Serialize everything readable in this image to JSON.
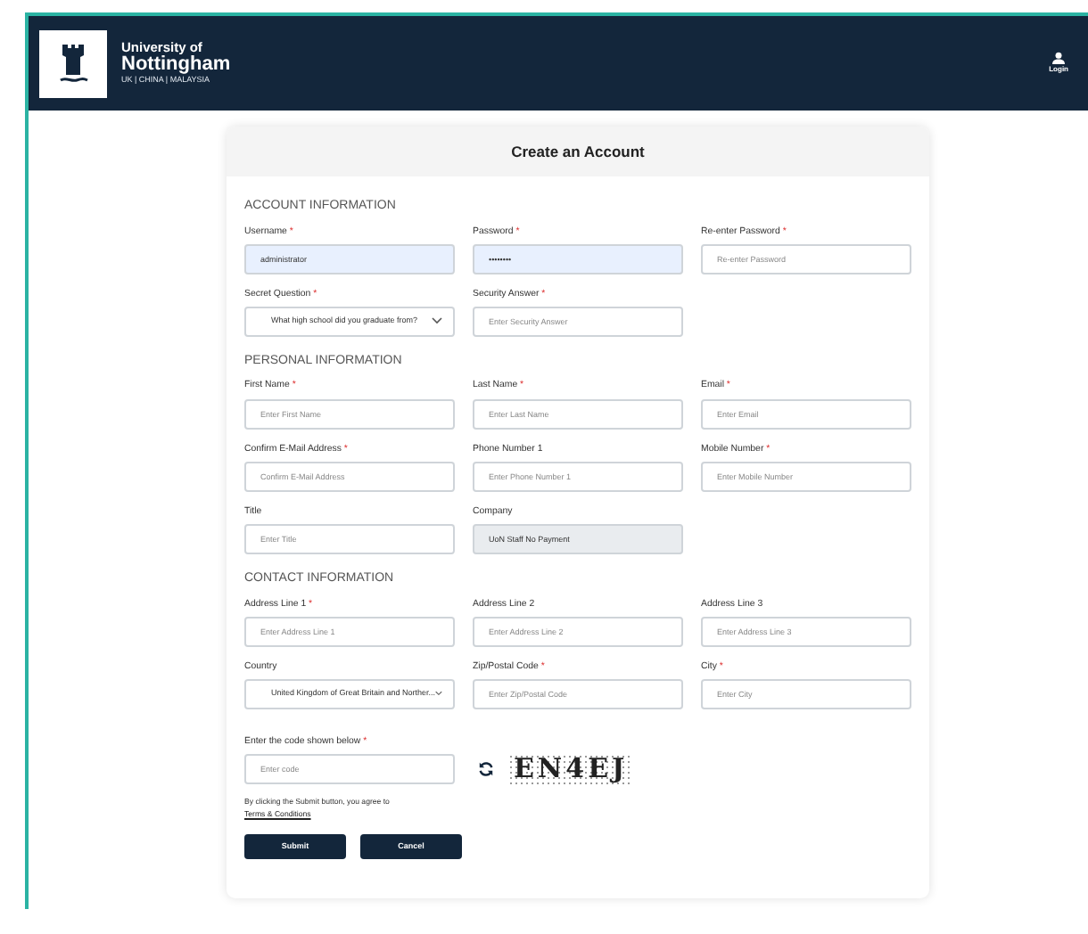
{
  "header": {
    "logo_lines": [
      "University of",
      "Nottingham",
      "UK | CHINA | MALAYSIA"
    ],
    "login": "Login"
  },
  "card": {
    "title": "Create an Account",
    "sections": [
      {
        "title": "ACCOUNT INFORMATION",
        "rows": [
          [
            {
              "kind": "input",
              "label": "Username",
              "required_mark": "*",
              "value": "administrator",
              "highlighted": true
            },
            {
              "kind": "input",
              "label": "Password",
              "required_mark": "*",
              "value": "••••••••",
              "highlighted": true
            },
            {
              "kind": "input",
              "label": "Re-enter Password",
              "required_mark": "*",
              "placeholder": "Re-enter Password",
              "highlighted": false
            }
          ],
          [
            {
              "kind": "select",
              "label": "Secret Question",
              "required_mark": "*",
              "value": "What high school did you graduate from?",
              "highlighted": false
            },
            {
              "kind": "input",
              "label": "Security Answer",
              "required_mark": "*",
              "placeholder": "Enter Security Answer",
              "highlighted": false
            }
          ]
        ]
      },
      {
        "title": "PERSONAL INFORMATION",
        "rows": [
          [
            {
              "kind": "input",
              "label": "First Name",
              "required_mark": "*",
              "placeholder": "Enter First Name",
              "highlighted": false
            },
            {
              "kind": "input",
              "label": "Last Name",
              "required_mark": "*",
              "placeholder": "Enter Last Name",
              "highlighted": false
            },
            {
              "kind": "input",
              "label": "Email",
              "required_mark": "*",
              "placeholder": "Enter Email",
              "highlighted": false
            }
          ],
          [
            {
              "kind": "input",
              "label": "Confirm E-Mail Address",
              "required_mark": "*",
              "placeholder": "Confirm E-Mail Address",
              "highlighted": false
            },
            {
              "kind": "input",
              "label": "Phone Number 1",
              "placeholder": "Enter Phone Number 1",
              "highlighted": false
            },
            {
              "kind": "input",
              "label": "Mobile Number",
              "required_mark": "*",
              "placeholder": "Enter Mobile Number",
              "highlighted": false
            }
          ],
          [
            {
              "kind": "input",
              "label": "Title",
              "placeholder": "Enter Title",
              "highlighted": false
            },
            {
              "kind": "readonly",
              "label": "Company",
              "value": "UoN Staff No Payment",
              "highlighted": false
            }
          ]
        ]
      },
      {
        "title": "CONTACT INFORMATION",
        "rows": [
          [
            {
              "kind": "input",
              "label": "Address Line 1",
              "required_mark": "*",
              "placeholder": "Enter Address Line 1",
              "highlighted": false
            },
            {
              "kind": "input",
              "label": "Address Line 2",
              "placeholder": "Enter Address Line 2",
              "highlighted": false
            },
            {
              "kind": "input",
              "label": "Address Line 3",
              "placeholder": "Enter Address Line 3",
              "highlighted": false
            }
          ],
          [
            {
              "kind": "select",
              "label": "Country",
              "value": "United Kingdom of Great Britain and Norther...",
              "highlighted": false
            },
            {
              "kind": "input",
              "label": "Zip/Postal Code",
              "required_mark": "*",
              "placeholder": "Enter Zip/Postal Code",
              "highlighted": false
            },
            {
              "kind": "input",
              "label": "City",
              "required_mark": "*",
              "placeholder": "Enter City",
              "highlighted": false
            }
          ]
        ]
      }
    ],
    "captcha": {
      "label": "Enter the code shown below",
      "required_mark": "*",
      "placeholder": "Enter code",
      "code": "EN4EJ"
    },
    "agreement": {
      "text": "By clicking the Submit button, you agree to",
      "link": "Terms & Conditions"
    },
    "buttons": [
      "Submit",
      "Cancel"
    ]
  }
}
